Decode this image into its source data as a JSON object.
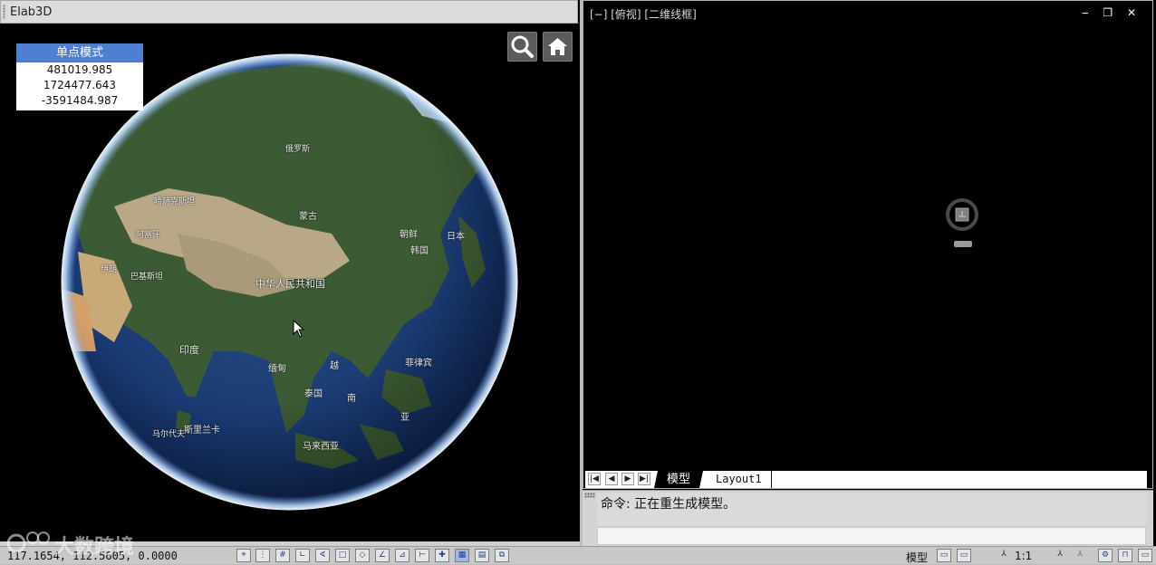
{
  "left_window": {
    "title": "Elab3D",
    "coord_panel": {
      "header": "单点模式",
      "values": [
        "481019.985",
        "1724477.643",
        "-3591484.987"
      ]
    },
    "buttons": {
      "search": "search-icon",
      "home": "home-icon"
    },
    "globe_labels": {
      "china": "中华人民共和国",
      "india": "印度",
      "myanmar": "缅甸",
      "thailand": "泰国",
      "vietnam_top": "越",
      "vietnam_bottom": "南",
      "philippines": "菲律宾",
      "malaysia": "马来西亚",
      "sri_lanka": "斯里兰卡",
      "maldives": "马尔代夫",
      "korea_n": "朝鲜",
      "korea_s": "韩国",
      "japan": "日本",
      "mongolia": "蒙古",
      "kazakhstan": "哈萨克斯坦",
      "indonesia": "亚",
      "pakistan": "巴基斯坦",
      "iran": "伊朗",
      "afghanistan": "阿富汗",
      "russia": "俄罗斯"
    }
  },
  "right_window": {
    "viewport_label": "[−] [俯视] [二维线框]",
    "window_controls": "‒ ❐ ✕",
    "tabs": {
      "model": "模型",
      "layout1": "Layout1"
    },
    "command_text": "命令: 正在重生成模型。"
  },
  "status_bar": {
    "coords": "117.1654, 112.5605, 0.0000",
    "model_label": "模型",
    "scale_label": "1:1"
  },
  "watermark": "大数跨境",
  "colors": {
    "coord_header": "#4e7fd1",
    "tab_active_bg": "#000000",
    "status_bg": "#c8c8c8"
  }
}
